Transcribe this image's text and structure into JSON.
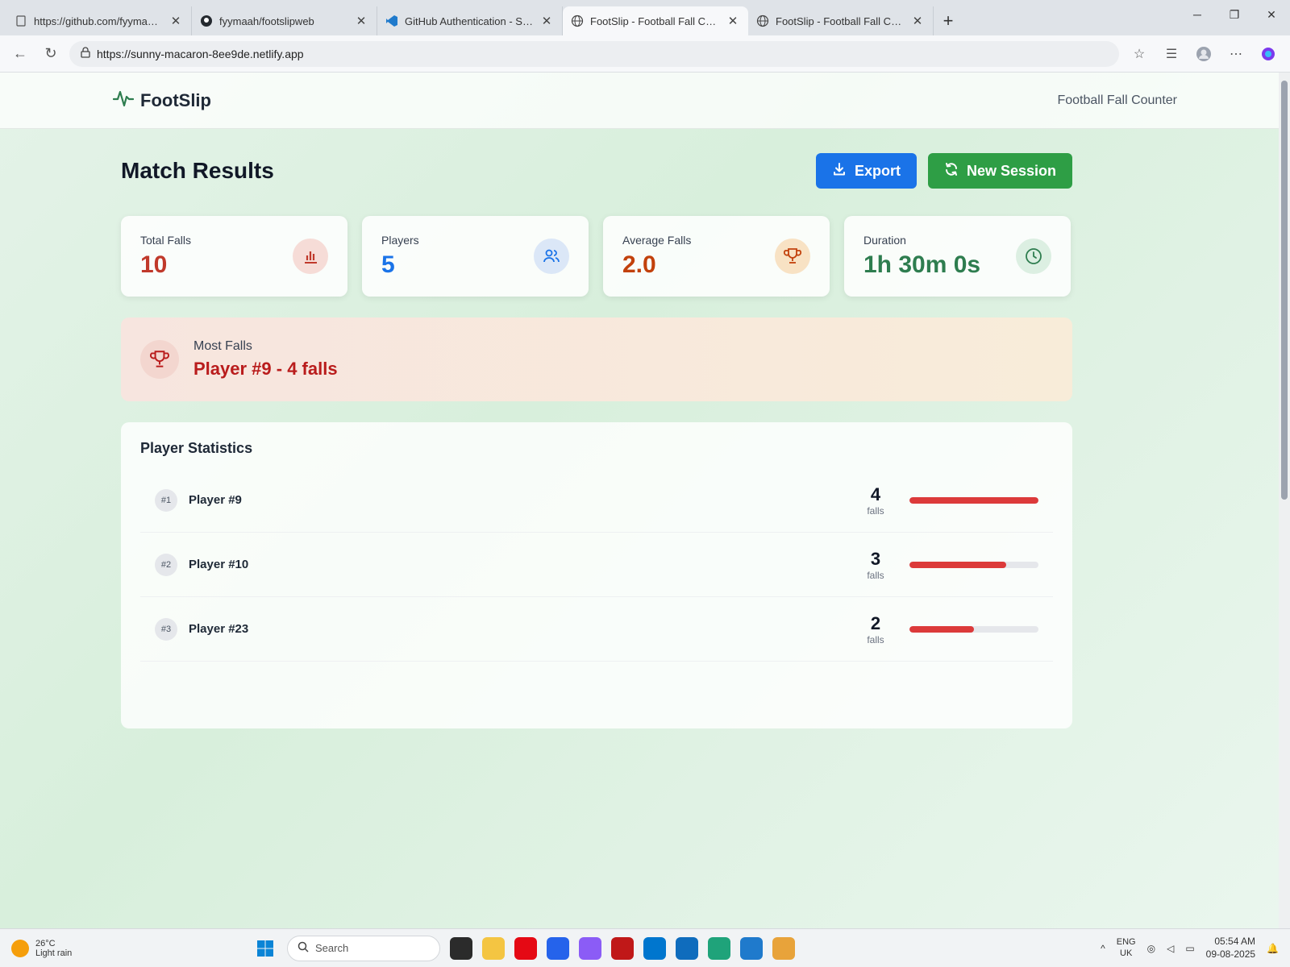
{
  "browser": {
    "tabs": [
      {
        "title": "https://github.com/fyymaah/foot",
        "icon": "page-icon",
        "active": false
      },
      {
        "title": "fyymaah/footslipweb",
        "icon": "github-icon",
        "active": false
      },
      {
        "title": "GitHub Authentication - Sign In",
        "icon": "vscode-icon",
        "active": false
      },
      {
        "title": "FootSlip - Football Fall Counter",
        "icon": "globe-icon",
        "active": true
      },
      {
        "title": "FootSlip - Football Fall Counter",
        "icon": "globe-icon",
        "active": false
      }
    ],
    "url": "https://sunny-macaron-8ee9de.netlify.app"
  },
  "nav": {
    "brand": "FootSlip",
    "subtitle": "Football Fall Counter"
  },
  "page": {
    "title": "Match Results",
    "export_label": "Export",
    "new_session_label": "New Session"
  },
  "stats": [
    {
      "label": "Total Falls",
      "value": "10",
      "color": "#c0392b",
      "icon": "bar-chart-icon",
      "icon_bg": "#f6dcd7"
    },
    {
      "label": "Players",
      "value": "5",
      "color": "#1a73e8",
      "icon": "users-icon",
      "icon_bg": "#dbe7f7"
    },
    {
      "label": "Average Falls",
      "value": "2.0",
      "color": "#c2410c",
      "icon": "trophy-icon",
      "icon_bg": "#f8e2c4"
    },
    {
      "label": "Duration",
      "value": "1h 30m 0s",
      "color": "#2e7d4f",
      "icon": "clock-icon",
      "icon_bg": "#dcefe2"
    }
  ],
  "most_falls": {
    "label": "Most Falls",
    "value": "Player #9 - 4 falls"
  },
  "player_stats": {
    "title": "Player Statistics",
    "unit": "falls",
    "rows": [
      {
        "rank": "#1",
        "name": "Player #9",
        "falls": "4",
        "fraction": 1.0
      },
      {
        "rank": "#2",
        "name": "Player #10",
        "falls": "3",
        "fraction": 0.75
      },
      {
        "rank": "#3",
        "name": "Player #23",
        "falls": "2",
        "fraction": 0.5
      }
    ]
  },
  "taskbar": {
    "weather_temp": "26°C",
    "weather_desc": "Light rain",
    "search_placeholder": "Search",
    "lang_1": "ENG",
    "lang_2": "UK",
    "time": "05:54 AM",
    "date": "09-08-2025"
  }
}
